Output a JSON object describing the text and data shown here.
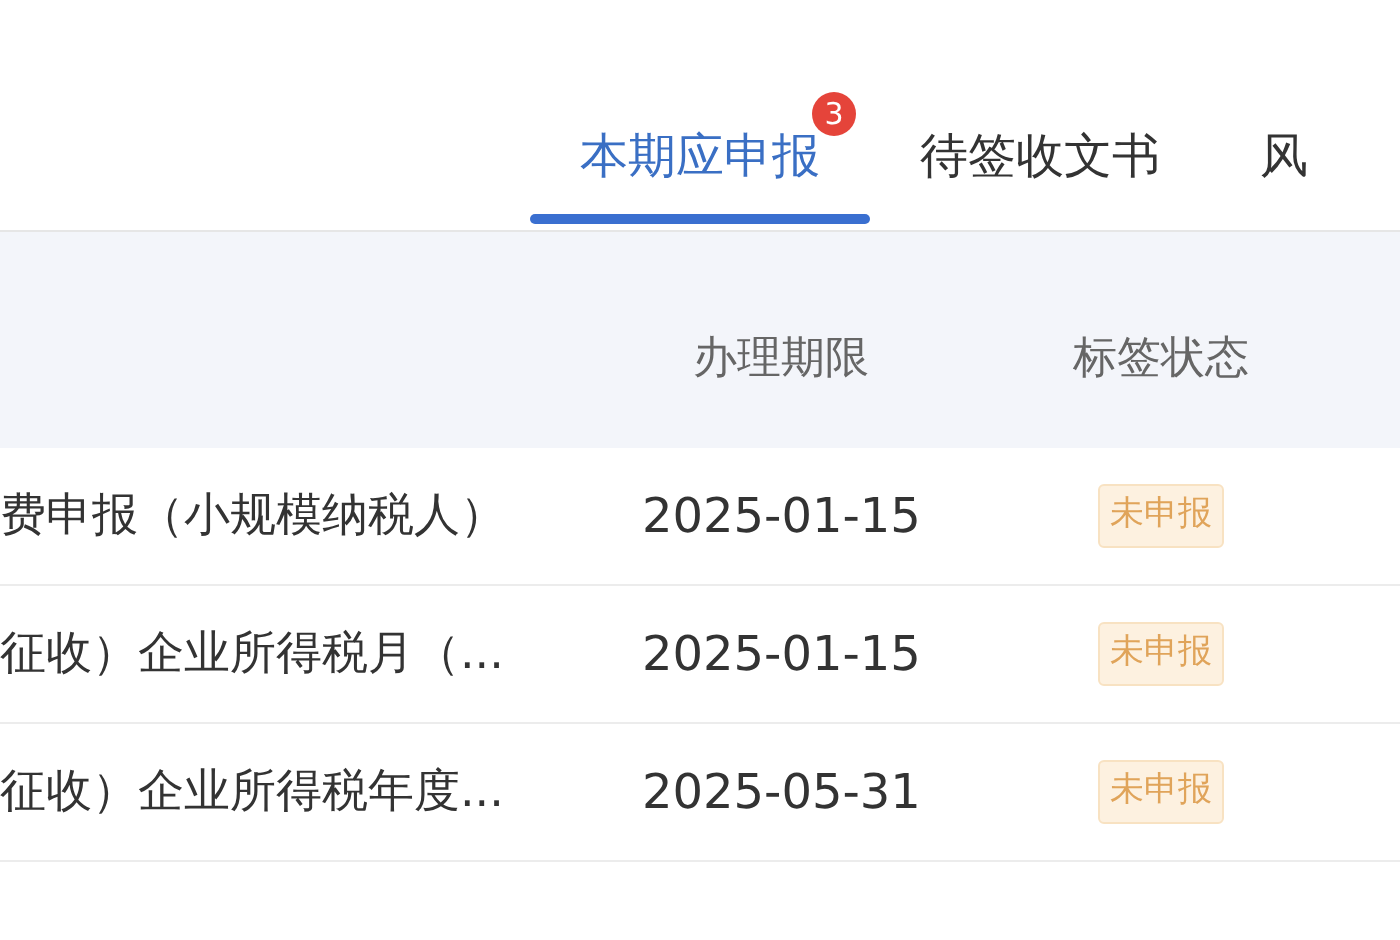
{
  "tabs": [
    {
      "label": "本期应申报",
      "selected": true,
      "badge": "3"
    },
    {
      "label": "待签收文书",
      "selected": false
    },
    {
      "label": "风",
      "selected": false
    }
  ],
  "table": {
    "columns": [
      "办理期限",
      "标签状态"
    ],
    "rows": [
      {
        "name": "费申报（小规模纳税人）",
        "deadline": "2025-01-15",
        "tag": "未申报"
      },
      {
        "name": "征收）企业所得税月（...",
        "deadline": "2025-01-15",
        "tag": "未申报"
      },
      {
        "name": "征收）企业所得税年度...",
        "deadline": "2025-05-31",
        "tag": "未申报"
      }
    ]
  }
}
